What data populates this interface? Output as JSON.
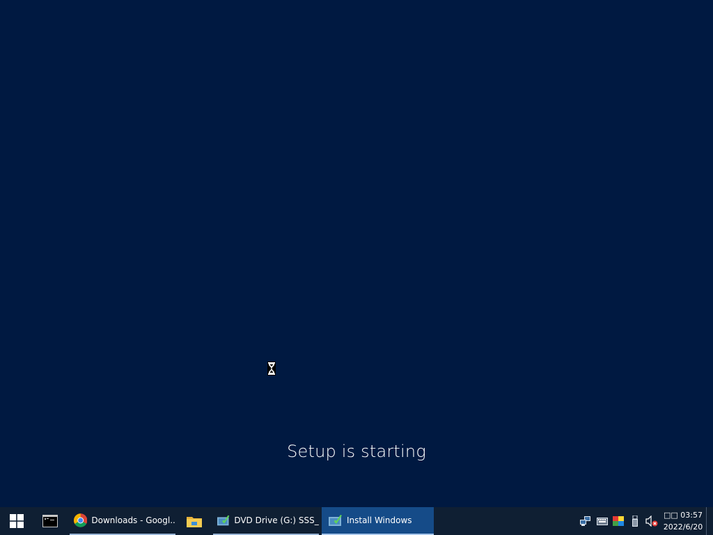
{
  "setup": {
    "message": "Setup is starting"
  },
  "taskbar": {
    "items": [
      {
        "name": "start-button",
        "icon": "windows-logo-icon"
      },
      {
        "name": "command-prompt",
        "icon": "command-prompt-icon"
      },
      {
        "name": "chrome",
        "label": "Downloads - Googl...",
        "icon": "chrome-icon"
      },
      {
        "name": "file-explorer",
        "icon": "folder-icon"
      },
      {
        "name": "dvd-drive",
        "label": "DVD Drive (G:) SSS_...",
        "icon": "setup-icon"
      },
      {
        "name": "install-windows",
        "label": "Install Windows",
        "icon": "setup-icon",
        "active": true
      }
    ]
  },
  "tray": {
    "icons": [
      "network-icon",
      "keyboard-icon",
      "display-color-icon",
      "usb-icon",
      "volume-muted-icon"
    ]
  },
  "clock": {
    "time": "□□ 03:57",
    "date": "2022/6/20"
  },
  "colors": {
    "background": "#001941",
    "taskbar": "#0f1f33",
    "active_task": "#154b88"
  }
}
